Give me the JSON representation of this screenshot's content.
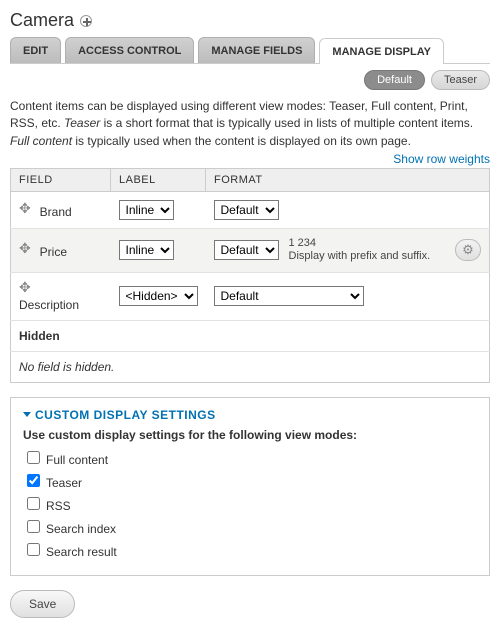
{
  "page": {
    "title": "Camera"
  },
  "tabs": {
    "edit": "EDIT",
    "access": "ACCESS CONTROL",
    "fields": "MANAGE FIELDS",
    "display": "MANAGE DISPLAY"
  },
  "subtabs": {
    "default": "Default",
    "teaser": "Teaser"
  },
  "help": {
    "p1a": "Content items can be displayed using different view modes: Teaser, Full content, Print, RSS, etc. ",
    "p1b_i": "Teaser",
    "p1c": " is a short format that is typically used in lists of multiple content items. ",
    "p1d_i": "Full content",
    "p1e": " is typically used when the content is displayed on its own page."
  },
  "show_row_weights": "Show row weights",
  "headers": {
    "field": "FIELD",
    "label": "LABEL",
    "format": "FORMAT"
  },
  "fields": [
    {
      "name": "Brand",
      "labelSel": "Inline",
      "format": "Default",
      "summary": ""
    },
    {
      "name": "Price",
      "labelSel": "Inline",
      "format": "Default",
      "summary_a": "1 234",
      "summary_b": "Display with prefix and suffix."
    },
    {
      "name": "Description",
      "labelSel": "<Hidden>",
      "format": "Default",
      "summary": ""
    }
  ],
  "hidden_section": {
    "title": "Hidden",
    "empty": "No field is hidden."
  },
  "custom": {
    "legend": "CUSTOM DISPLAY SETTINGS",
    "lead": "Use custom display settings for the following view modes:",
    "options": [
      {
        "label": "Full content",
        "checked": false
      },
      {
        "label": "Teaser",
        "checked": true
      },
      {
        "label": "RSS",
        "checked": false
      },
      {
        "label": "Search index",
        "checked": false
      },
      {
        "label": "Search result",
        "checked": false
      }
    ]
  },
  "save": "Save"
}
